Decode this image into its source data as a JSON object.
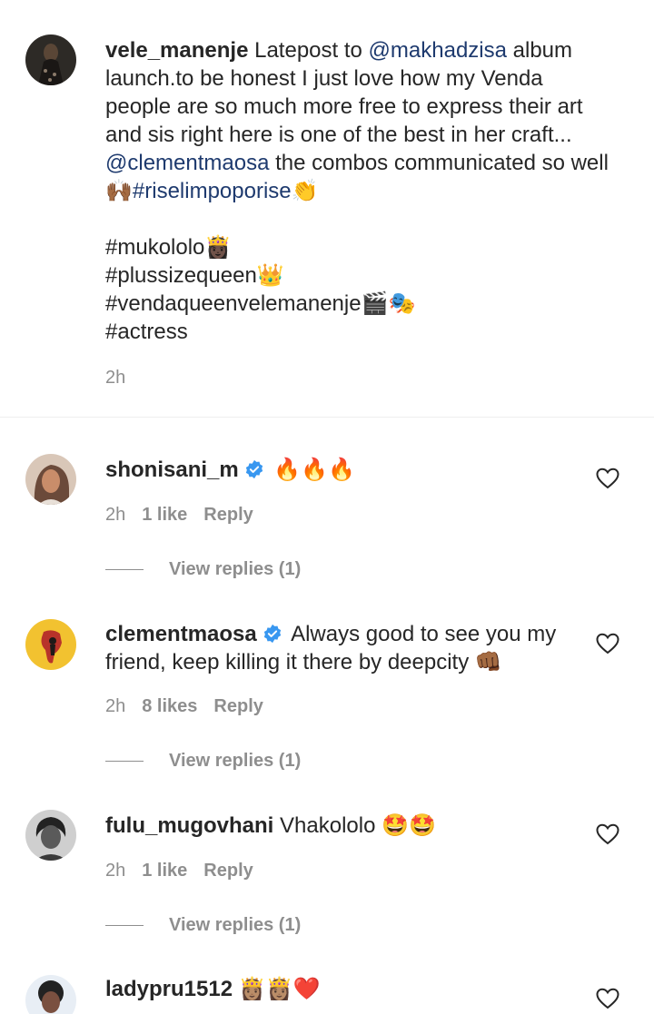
{
  "post": {
    "username": "vele_manenje",
    "caption_lead": "Latepost to ",
    "mention_1": "@makhadzisa",
    "caption_mid": " album launch.to be honest I just love how my Venda people are so much more free to express their art and sis right here is one of the best in her craft...",
    "mention_2": "@clementmaosa",
    "caption_tail": " the combos communicated so well ",
    "emoji_hands": "🙌🏾",
    "hashtag_1": "#riselimpoporise",
    "emoji_clap": "👏",
    "hashtags": [
      "#mukololo👸🏿",
      "#plussizequeen👑",
      "#vendaqueenvelemanenje🎬🎭",
      "#actress"
    ],
    "time": "2h"
  },
  "comments": [
    {
      "username": "shonisani_m",
      "verified": true,
      "text": "🔥🔥🔥",
      "time": "2h",
      "likes": "1 like",
      "reply_label": "Reply",
      "view_replies": "View replies (1)"
    },
    {
      "username": "clementmaosa",
      "verified": true,
      "text": "Always good to see you my friend, keep killing it there by deepcity 👊🏾",
      "time": "2h",
      "likes": "8 likes",
      "reply_label": "Reply",
      "view_replies": "View replies (1)"
    },
    {
      "username": "fulu_mugovhani",
      "verified": false,
      "text": "Vhakololo 🤩🤩",
      "time": "2h",
      "likes": "1 like",
      "reply_label": "Reply",
      "view_replies": "View replies (1)"
    },
    {
      "username": "ladypru1512",
      "verified": false,
      "text": "👸🏽👸🏽❤️"
    }
  ],
  "colors": {
    "text": "#262626",
    "link": "#1e3a6e",
    "muted": "#8e8e8e",
    "verified": "#3897f0"
  },
  "icons": {
    "like": "heart-outline-icon",
    "verified": "verified-badge-icon"
  }
}
